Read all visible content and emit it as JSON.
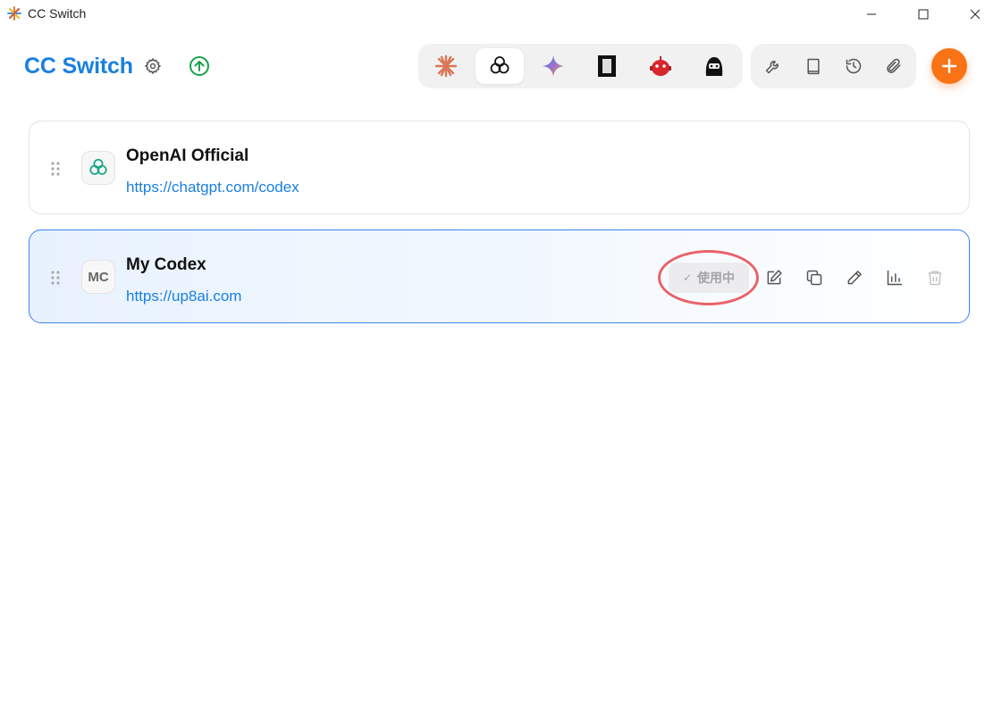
{
  "window": {
    "title": "CC Switch",
    "app_icon": "starburst-icon",
    "controls": [
      "minimize-icon",
      "maximize-icon",
      "close-icon"
    ]
  },
  "header": {
    "brand": "CC Switch",
    "settings_icon": "gear-icon",
    "update_icon": "arrow-up-circle-icon",
    "add_icon": "plus-icon",
    "accent": "#1a7fe0",
    "add_color": "#f97316"
  },
  "app_tabs": [
    {
      "name": "claude",
      "icon": "claude-starburst-icon",
      "active": false
    },
    {
      "name": "codex",
      "icon": "openai-icon",
      "active": true
    },
    {
      "name": "gemini",
      "icon": "gemini-sparkle-icon",
      "active": false
    },
    {
      "name": "terminal",
      "icon": "terminal-app-icon",
      "active": false
    },
    {
      "name": "robot",
      "icon": "robot-icon",
      "active": false
    },
    {
      "name": "ninja",
      "icon": "ninja-icon",
      "active": false
    }
  ],
  "tools": [
    "wrench-icon",
    "book-icon",
    "history-icon",
    "paperclip-icon"
  ],
  "providers": [
    {
      "name": "OpenAI Official",
      "url": "https://chatgpt.com/codex",
      "logo_icon": "openai-icon",
      "active": false
    },
    {
      "name": "My Codex",
      "url": "https://up8ai.com",
      "logo_text": "MC",
      "active": true,
      "status": "使用中"
    }
  ],
  "row_actions": [
    "edit-icon",
    "copy-icon",
    "pencil-icon",
    "chart-bars-icon",
    "trash-icon"
  ],
  "highlight_color": "#e5484d"
}
